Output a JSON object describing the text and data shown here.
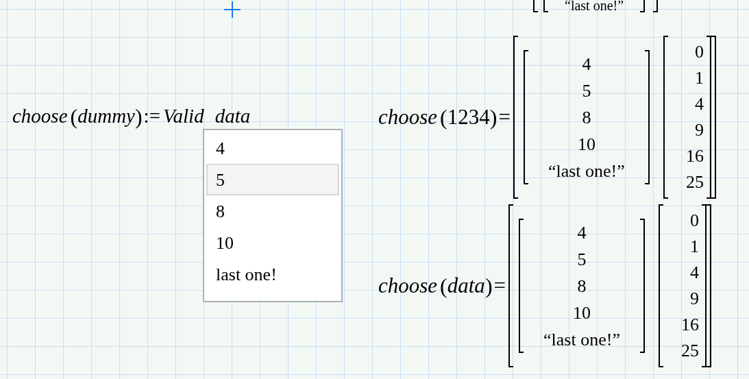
{
  "top_fragment": {
    "text": "“last one!”"
  },
  "definition": {
    "function": "choose",
    "left_paren": "(",
    "argument": "dummy",
    "right_paren": ")",
    "operator": ":=",
    "value_words": [
      "Valid",
      "data"
    ]
  },
  "dropdown": {
    "items": [
      {
        "label": "4",
        "selected": false
      },
      {
        "label": "5",
        "selected": true
      },
      {
        "label": "8",
        "selected": false
      },
      {
        "label": "10",
        "selected": false
      },
      {
        "label": "last one!",
        "selected": false
      }
    ]
  },
  "results": [
    {
      "function": "choose",
      "left_paren": "(",
      "argument": "1234",
      "argument_italic": false,
      "right_paren": ")",
      "operator": "=",
      "column_1": [
        "4",
        "5",
        "8",
        "10",
        "“last one!”"
      ],
      "column_2": [
        "0",
        "1",
        "4",
        "9",
        "16",
        "25"
      ]
    },
    {
      "function": "choose",
      "left_paren": "(",
      "argument": "data",
      "argument_italic": true,
      "right_paren": ")",
      "operator": "=",
      "column_1": [
        "4",
        "5",
        "8",
        "10",
        "“last one!”"
      ],
      "column_2": [
        "0",
        "1",
        "4",
        "9",
        "16",
        "25"
      ]
    }
  ]
}
